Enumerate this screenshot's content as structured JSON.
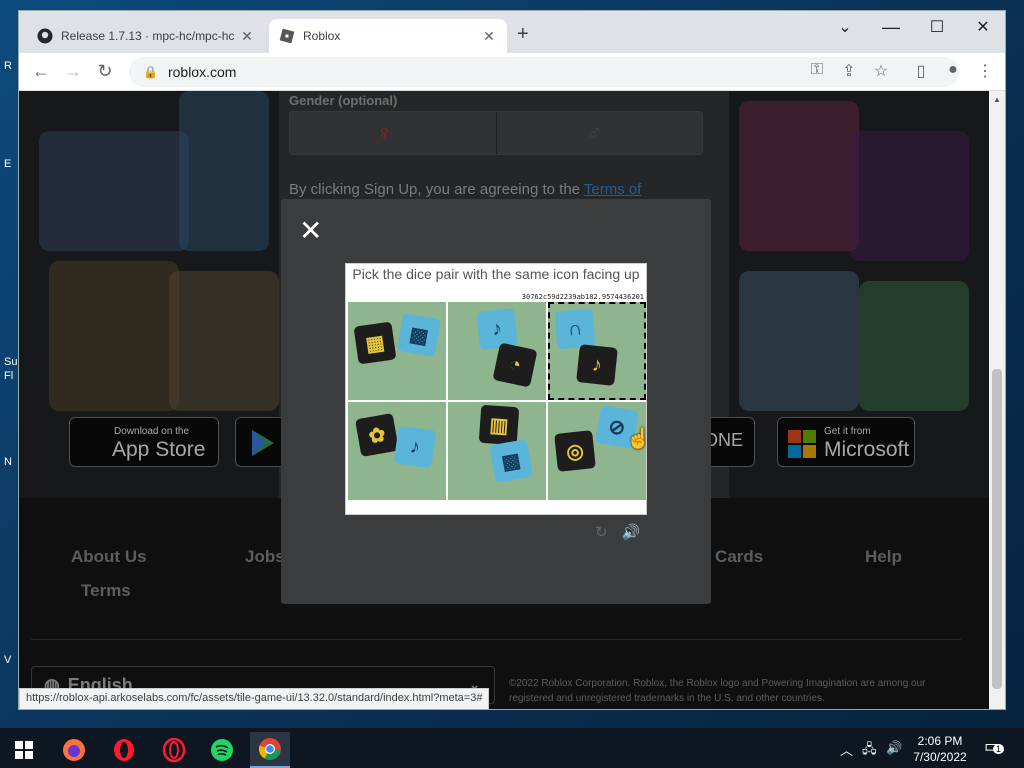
{
  "desktop": {
    "fragments": [
      "R",
      "E",
      "Su",
      "Fl",
      "N",
      "V"
    ]
  },
  "browser": {
    "tabs": [
      {
        "label": "Release 1.7.13 · mpc-hc/mpc-hc",
        "icon": "github-icon"
      },
      {
        "label": "Roblox",
        "icon": "roblox-icon"
      }
    ],
    "url": "roblox.com",
    "status_url": "https://roblox-api.arkoselabs.com/fc/assets/tile-game-ui/13.32.0/standard/index.html?meta=3#"
  },
  "page": {
    "gender_label": "Gender (optional)",
    "terms_text": "By clicking Sign Up, you are agreeing to the ",
    "terms_link": "Terms of",
    "stores": {
      "apple_small": "Download on the",
      "apple_big": "App Store",
      "xbox_partial": "ONE",
      "ms_small": "Get it from",
      "ms_big": "Microsoft"
    },
    "footer": {
      "links": [
        "About Us",
        "Jobs",
        "ft Cards",
        "Help",
        "Terms"
      ],
      "language": "English",
      "copyright": "©2022 Roblox Corporation. Roblox, the Roblox logo and Powering Imagination are among our registered and unregistered trademarks in the U.S. and other countries."
    }
  },
  "captcha": {
    "instruction": "Pick the dice pair with the same icon facing up",
    "code": "30762c59d2239ab182.9574436201",
    "selected_tile": 3
  },
  "taskbar": {
    "time": "2:06 PM",
    "date": "7/30/2022",
    "notifications": "1"
  },
  "colors": {
    "accent_link": "#3a8ed8",
    "page_bg": "#232527",
    "modal_bg": "#3b3c3e"
  }
}
